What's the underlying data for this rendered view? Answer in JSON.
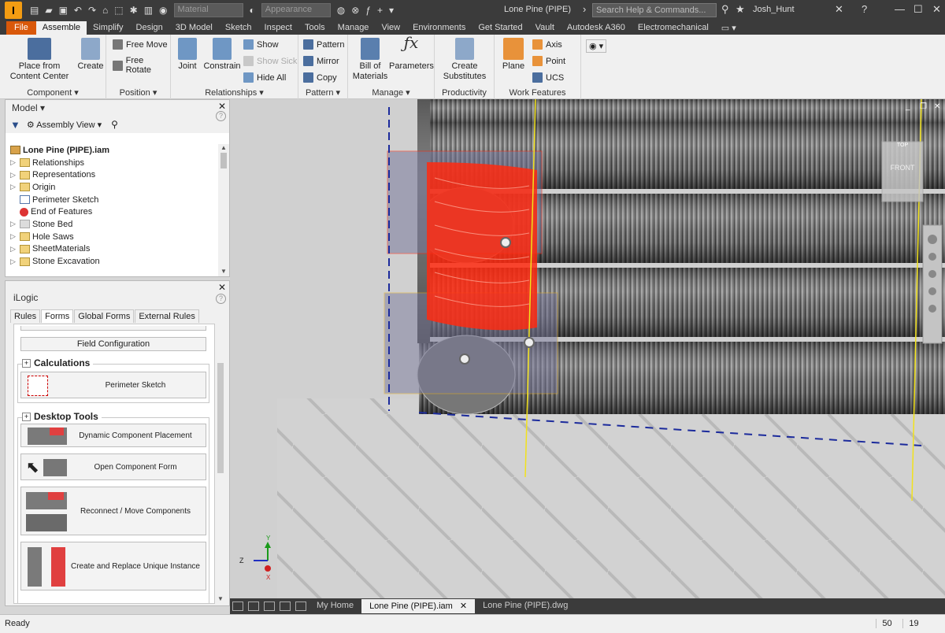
{
  "app": {
    "title": "Lone Pine (PIPE)",
    "search_placeholder": "Search Help & Commands...",
    "user": "Josh_Hunt",
    "material_placeholder": "Material",
    "appearance_placeholder": "Appearance"
  },
  "ribbon_tabs": [
    "File",
    "Assemble",
    "Simplify",
    "Design",
    "3D Model",
    "Sketch",
    "Inspect",
    "Tools",
    "Manage",
    "View",
    "Environments",
    "Get Started",
    "Vault",
    "Autodesk A360",
    "Electromechanical"
  ],
  "active_tab": "Assemble",
  "ribbon": {
    "component": {
      "label": "Component",
      "place_from_content_center_line1": "Place from",
      "place_from_content_center_line2": "Content Center",
      "create": "Create"
    },
    "position": {
      "label": "Position",
      "free_move": "Free Move",
      "free_rotate": "Free Rotate"
    },
    "relationships": {
      "label": "Relationships",
      "joint": "Joint",
      "constrain": "Constrain",
      "show": "Show",
      "show_sick": "Show Sick",
      "hide_all": "Hide All"
    },
    "pattern": {
      "label": "Pattern",
      "pattern": "Pattern",
      "mirror": "Mirror",
      "copy": "Copy"
    },
    "manage": {
      "label": "Manage",
      "bill_of_materials_line1": "Bill of",
      "bill_of_materials_line2": "Materials",
      "parameters": "Parameters"
    },
    "productivity": {
      "label": "Productivity",
      "create_substitutes_line1": "Create",
      "create_substitutes_line2": "Substitutes"
    },
    "work_features": {
      "label": "Work Features",
      "plane": "Plane",
      "axis": "Axis",
      "point": "Point",
      "ucs": "UCS"
    }
  },
  "model_panel": {
    "title": "Model",
    "view_mode": "Assembly View",
    "root": "Lone Pine (PIPE).iam",
    "nodes": [
      {
        "label": "Relationships",
        "icon": "folder-icon"
      },
      {
        "label": "Representations",
        "icon": "folder-icon"
      },
      {
        "label": "Origin",
        "icon": "folder-icon"
      },
      {
        "label": "Perimeter Sketch",
        "icon": "sketch-icon"
      },
      {
        "label": "End of Features",
        "icon": "end-of-features-icon"
      },
      {
        "label": "Stone Bed",
        "icon": "part-icon"
      },
      {
        "label": "Hole Saws",
        "icon": "folder-icon"
      },
      {
        "label": "SheetMaterials",
        "icon": "folder-icon"
      },
      {
        "label": "Stone Excavation",
        "icon": "folder-icon"
      }
    ]
  },
  "ilogic_panel": {
    "title": "iLogic",
    "tabs": [
      "Rules",
      "Forms",
      "Global Forms",
      "External Rules"
    ],
    "active_tab": "Forms",
    "field_configuration": "Field Configuration",
    "calculations_header": "Calculations",
    "perimeter_sketch": "Perimeter Sketch",
    "desktop_tools_header": "Desktop Tools",
    "dynamic_component_placement": "Dynamic Component Placement",
    "open_component_form": "Open Component Form",
    "reconnect_move_components": "Reconnect / Move Components",
    "create_and_replace_unique_instance": "Create and Replace Unique Instance"
  },
  "viewcube": {
    "top": "TOP",
    "front": "FRONT"
  },
  "triad": {
    "x": "X",
    "y": "Y",
    "z": "Z"
  },
  "doc_tabs": [
    "My Home",
    "Lone Pine (PIPE).iam",
    "Lone Pine (PIPE).dwg"
  ],
  "active_doc_tab": "Lone Pine (PIPE).iam",
  "status": {
    "text": "Ready",
    "value1": "50",
    "value2": "19"
  },
  "colors": {
    "accent": "#d9580a",
    "selection": "#ff2a10",
    "work_axis": "#f2e21b",
    "dark_bar": "#3b3b3b"
  }
}
